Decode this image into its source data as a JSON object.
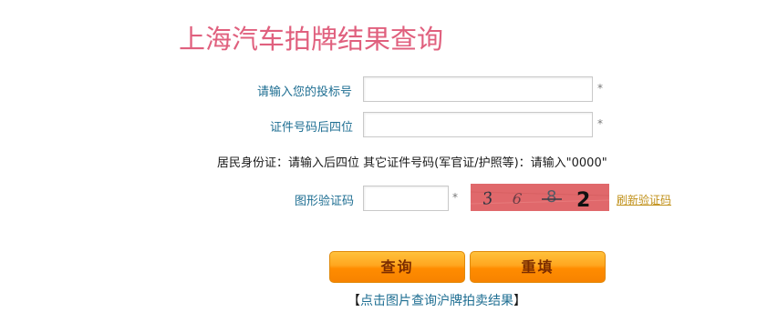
{
  "page_title": "上海汽车拍牌结果查询",
  "form": {
    "bid_number": {
      "label": "请输入您的投标号",
      "value": "",
      "required_mark": "*"
    },
    "id_last4": {
      "label": "证件号码后四位",
      "value": "",
      "required_mark": "*"
    },
    "id_hint": "居民身份证：请输入后四位 其它证件号码(军官证/护照等)：请输入\"0000\"",
    "captcha": {
      "label": "图形验证码",
      "value": "",
      "required_mark": "*",
      "image_chars": [
        "3",
        "6",
        "8",
        "2"
      ],
      "refresh_label": "刷新验证码"
    }
  },
  "buttons": {
    "query": "查询",
    "reset": "重填"
  },
  "bottom_link": {
    "open_bracket": "【",
    "text": "点击图片查询沪牌拍卖结果",
    "close_bracket": "】"
  },
  "colors": {
    "title": "#e0607e",
    "label": "#1e6e92",
    "button_gradient_top": "#ffc23c",
    "button_gradient_bottom": "#f78300",
    "captcha_bg": "#e0686b",
    "refresh_link": "#c09018"
  }
}
